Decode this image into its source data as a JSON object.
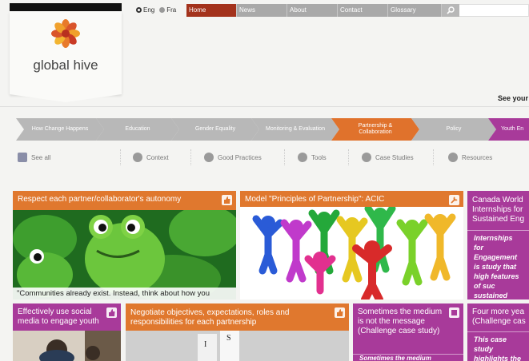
{
  "lang": {
    "english": "Eng",
    "french": "Fra"
  },
  "nav": [
    "Home",
    "News",
    "About",
    "Contact",
    "Glossary"
  ],
  "brand": "global hive",
  "see_your": "See your v",
  "chevrons": [
    {
      "label": "How Change Happens",
      "state": "grey"
    },
    {
      "label": "Education",
      "state": "grey"
    },
    {
      "label": "Gender Equality",
      "state": "grey"
    },
    {
      "label": "Monitoring & Evaluation",
      "state": "grey"
    },
    {
      "label": "Partnership & Collaboration",
      "state": "orange"
    },
    {
      "label": "Policy",
      "state": "grey"
    },
    {
      "label": "Youth En",
      "state": "purple"
    }
  ],
  "subnav": [
    "See all",
    "Context",
    "Good Practices",
    "Tools",
    "Case Studies",
    "Resources"
  ],
  "cards": {
    "c1": {
      "title": "Respect each partner/collaborator's autonomy",
      "caption": "\"Communities already exist.  Instead, think about how you"
    },
    "c2": {
      "title": "Model \"Principles of Partnership\": ACIC"
    },
    "c3": {
      "title": "Canada World Internships for Sustained Eng",
      "body": "Internships for Engagement is study that high features of suc sustained enga The..."
    },
    "c4": {
      "title": "Effectively use social media to engage youth"
    },
    "c5": {
      "title": "Negotiate objectives, expectations, roles and responsibilities for each partnership"
    },
    "c6": {
      "title": "Sometimes the medium is not the message (Challenge case study)",
      "body": "Sometimes the medium"
    },
    "c7": {
      "title": "Four more yea (Challenge cas",
      "body": "This case study highlights the c"
    }
  },
  "colors": {
    "orange": "#e0782e",
    "purple": "#a83a9a",
    "home_red": "#a3321c",
    "nav_grey": "#a9a9a9"
  }
}
